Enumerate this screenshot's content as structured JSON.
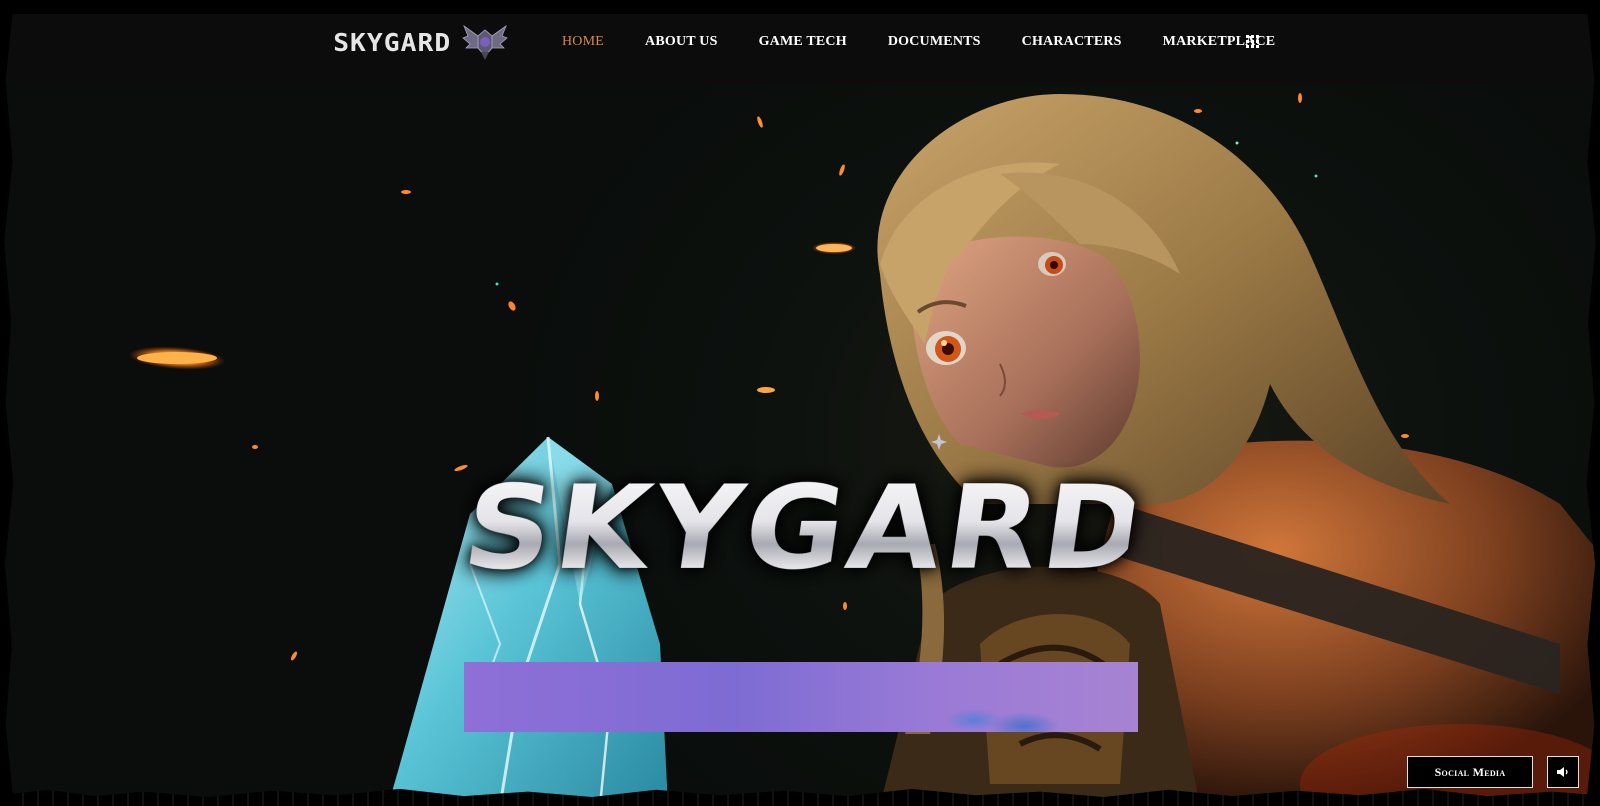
{
  "nav": {
    "brand": "SKYGARD",
    "items": [
      {
        "label": "HOME",
        "active": true
      },
      {
        "label": "ABOUT US",
        "active": false
      },
      {
        "label": "GAME TECH",
        "active": false
      },
      {
        "label": "DOCUMENTS",
        "active": false
      },
      {
        "label": "CHARACTERS",
        "active": false
      },
      {
        "label": "MARKETPLACE",
        "active": false
      }
    ],
    "menu_icon": "grid-dots-icon"
  },
  "hero": {
    "title": "SKYGARD"
  },
  "controls": {
    "social_label": "Social Media",
    "sound_icon": "speaker-icon"
  },
  "colors": {
    "accent": "#d98a3d",
    "nav_bg": "#0c0c0c",
    "hero_bg": "#0b0e0c",
    "ember": "#ff9a2a",
    "crystal": "#6fd6e8",
    "video_thumb": "#8f6fd8"
  }
}
